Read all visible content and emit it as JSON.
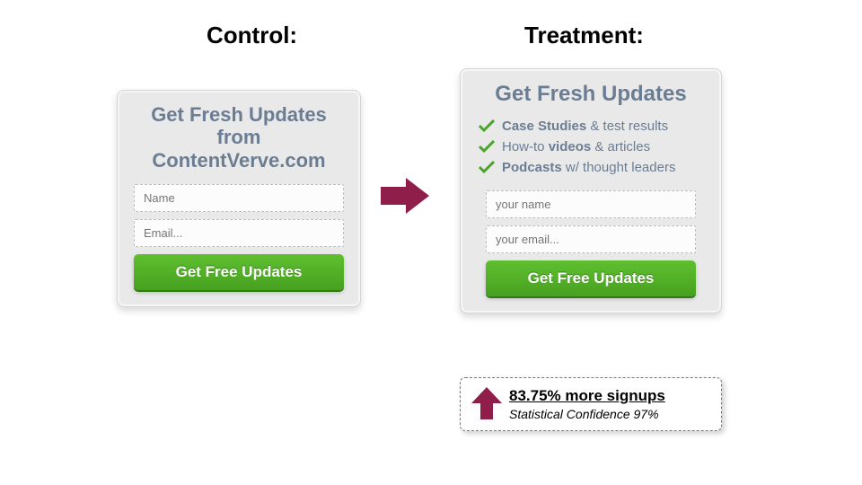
{
  "headings": {
    "control": "Control:",
    "treatment": "Treatment:"
  },
  "control": {
    "title": "Get Fresh Updates from ContentVerve.com",
    "name_placeholder": "Name",
    "email_placeholder": "Email...",
    "cta": "Get Free Updates"
  },
  "treatment": {
    "title": "Get Fresh Updates",
    "bullets": [
      {
        "bold_a": "Case Studies",
        "rest_a": " & test results"
      },
      {
        "pre_b": "How-to ",
        "bold_b": "videos",
        "rest_b": " & articles"
      },
      {
        "bold_c": "Podcasts",
        "rest_c": " w/ thought leaders"
      }
    ],
    "name_placeholder": "your name",
    "email_placeholder": "your email...",
    "cta": "Get Free Updates"
  },
  "result": {
    "title": "83.75% more signups",
    "subtitle": "Statistical Confidence 97%"
  },
  "colors": {
    "accent_arrow": "#8f1f4a",
    "cta_green": "#46a11f",
    "check_green": "#4aa52a"
  }
}
